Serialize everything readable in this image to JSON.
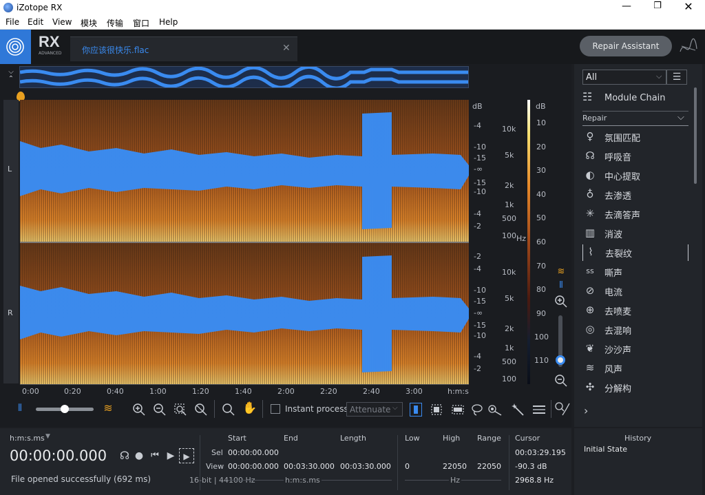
{
  "app": {
    "title": "iZotope RX"
  },
  "menu": [
    "File",
    "Edit",
    "View",
    "模块",
    "传输",
    "窗口",
    "Help"
  ],
  "tab": {
    "filename": "你应该很快乐.flac"
  },
  "repair_assistant": "Repair Assistant",
  "logo": {
    "rx": "RX",
    "sub": "ADVANCED"
  },
  "channels": {
    "left": "L",
    "right": "R"
  },
  "freq_axis": {
    "db_label": "dB",
    "left_labels": [
      "-4",
      "-10",
      "-15",
      "-∞",
      "-15",
      "-10",
      "-4",
      "-2"
    ],
    "right_labels": [
      "-2",
      "-4",
      "-10",
      "-15",
      "-∞",
      "-15",
      "-10",
      "-4",
      "-2"
    ],
    "hz_left": [
      "10k",
      "5k",
      "2k",
      "1k",
      "500",
      "100"
    ],
    "hz_right": [
      "10k",
      "5k",
      "2k",
      "1k",
      "500",
      "100"
    ],
    "hz_unit": "Hz"
  },
  "color_scale": {
    "label": "dB",
    "ticks": [
      "10",
      "20",
      "30",
      "40",
      "50",
      "60",
      "70",
      "80",
      "90",
      "100",
      "110"
    ]
  },
  "time_axis": [
    "0:00",
    "0:20",
    "0:40",
    "1:00",
    "1:20",
    "1:40",
    "2:00",
    "2:20",
    "2:40",
    "3:00",
    "h:m:s"
  ],
  "toolbar": {
    "instant_process": "Instant process",
    "attenuate": "Attenuate"
  },
  "module_panel": {
    "filter": "All",
    "chain": "Module Chain",
    "section": "Repair",
    "items": [
      {
        "label": "氛围匹配",
        "icon": "ambience-match-icon",
        "glyph": "♀"
      },
      {
        "label": "呼吸音",
        "icon": "breath-icon",
        "glyph": "☊"
      },
      {
        "label": "中心提取",
        "icon": "center-extract-icon",
        "glyph": "◐"
      },
      {
        "label": "去渗透",
        "icon": "debleed-icon",
        "glyph": "♁"
      },
      {
        "label": "去滴答声",
        "icon": "declick-icon",
        "glyph": "✳"
      },
      {
        "label": "消波",
        "icon": "declip-icon",
        "glyph": "▥"
      },
      {
        "label": "去裂纹",
        "icon": "decrackle-icon",
        "glyph": "⌇"
      },
      {
        "label": "嘶声",
        "icon": "deess-icon",
        "glyph": "ss"
      },
      {
        "label": "电流",
        "icon": "dehum-icon",
        "glyph": "⊘"
      },
      {
        "label": "去喷麦",
        "icon": "deplosive-icon",
        "glyph": "⊕"
      },
      {
        "label": "去混响",
        "icon": "dereverb-icon",
        "glyph": "◎"
      },
      {
        "label": "沙沙声",
        "icon": "derustle-icon",
        "glyph": "❦"
      },
      {
        "label": "风声",
        "icon": "dewind-icon",
        "glyph": "≋"
      },
      {
        "label": "分解构",
        "icon": "deconstruct-icon",
        "glyph": "✣"
      }
    ]
  },
  "transport": {
    "format": "h:m:s.ms",
    "time": "00:00:00.000",
    "status": "File opened successfully (692 ms)",
    "bit_info": "16-bit | 44100 Hz"
  },
  "selection": {
    "headers": {
      "start": "Start",
      "end": "End",
      "length": "Length",
      "low": "Low",
      "high": "High",
      "range": "Range",
      "cursor": "Cursor"
    },
    "sel_label": "Sel",
    "view_label": "View",
    "sel_start": "00:00:00.000",
    "view_start": "00:00:00.000",
    "view_end": "00:03:30.000",
    "view_length": "00:03:30.000",
    "low": "0",
    "high": "22050",
    "range": "22050",
    "cursor_time": "00:03:29.195",
    "cursor_db": "-90.3 dB",
    "cursor_hz": "2968.8 Hz",
    "unit_time": "h:m:s.ms",
    "unit_hz": "Hz"
  },
  "history": {
    "title": "History",
    "items": [
      "Initial State"
    ]
  },
  "colors": {
    "accent": "#3a8bf0",
    "background": "#1c1e22",
    "spectro_orange": "#e88a2a"
  }
}
